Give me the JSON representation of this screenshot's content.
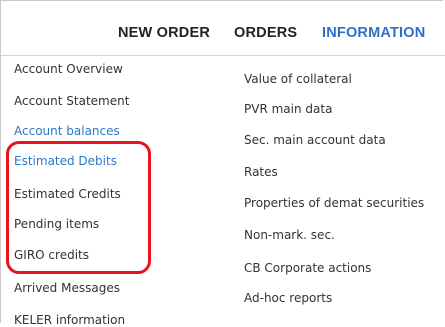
{
  "topnav": {
    "items": [
      {
        "label": "NEW ORDER"
      },
      {
        "label": "ORDERS"
      },
      {
        "label": "INFORMATION",
        "active": true
      }
    ]
  },
  "left_menu": {
    "items": [
      {
        "label": "Account Overview"
      },
      {
        "label": "Account Statement"
      },
      {
        "label": "Account balances",
        "active": true
      },
      {
        "label": "Estimated Debits",
        "active": true
      },
      {
        "label": "Estimated Credits"
      },
      {
        "label": "Pending items"
      },
      {
        "label": "GIRO credits"
      },
      {
        "label": "Arrived Messages"
      },
      {
        "label": "KELER information"
      }
    ]
  },
  "right_menu": {
    "items": [
      {
        "label": "Value of collateral"
      },
      {
        "label": "PVR main data"
      },
      {
        "label": "Sec. main account data"
      },
      {
        "label": "Rates"
      },
      {
        "label": "Properties of demat securities"
      },
      {
        "label": "Non-mark. sec."
      },
      {
        "label": "CB Corporate actions"
      },
      {
        "label": "Ad-hoc reports"
      }
    ]
  },
  "colors": {
    "accent": "#2d6fc4",
    "annotation": "#e8141b",
    "text": "#333333"
  }
}
